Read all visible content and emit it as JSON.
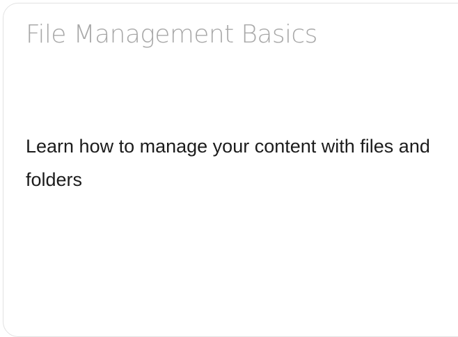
{
  "card": {
    "title": "File Management Basics",
    "description": "Learn how to manage your content with files and folders"
  }
}
